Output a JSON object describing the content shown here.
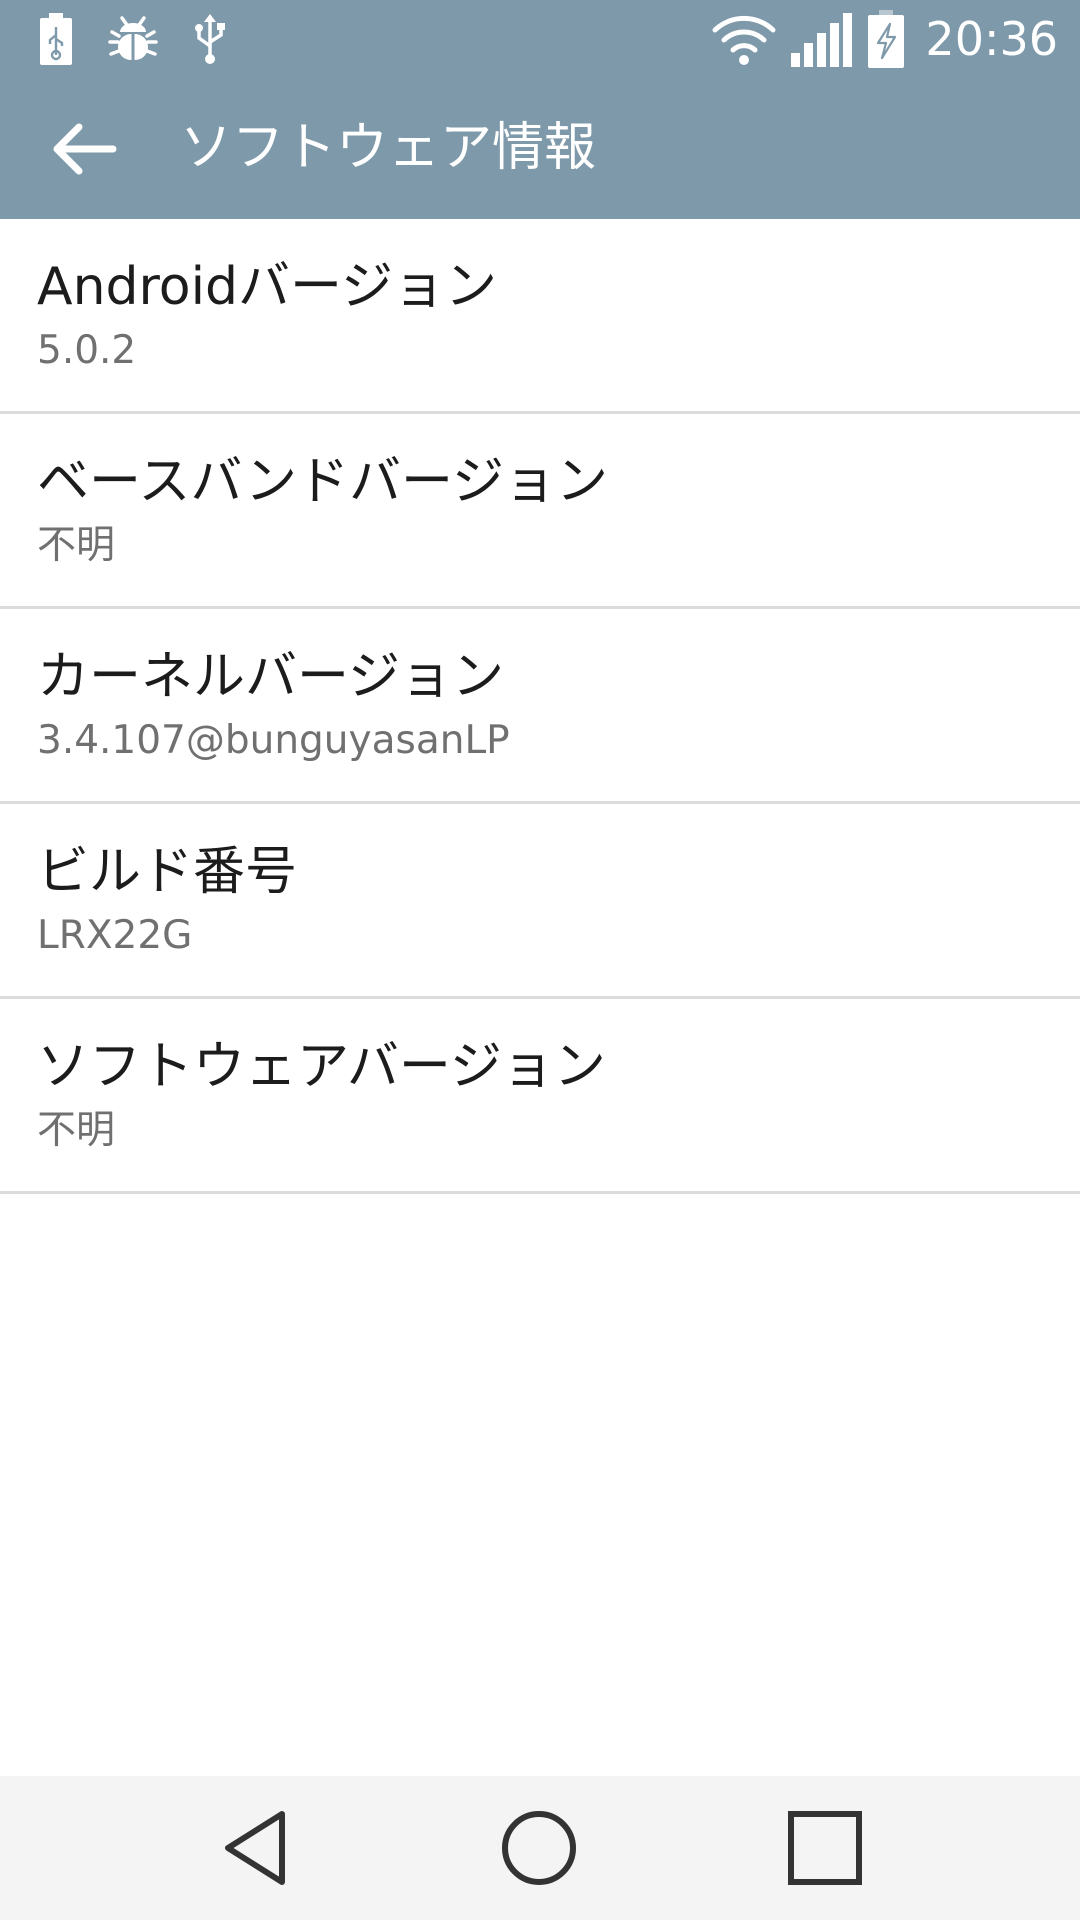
{
  "status_bar": {
    "time": "20:36",
    "left_icons": [
      "battery-usb-icon",
      "bug-icon",
      "usb-icon"
    ],
    "right_icons": [
      "wifi-icon",
      "signal-icon",
      "battery-charging-icon"
    ]
  },
  "action_bar": {
    "back_icon": "arrow-back-icon",
    "title": "ソフトウェア情報"
  },
  "items": [
    {
      "title": "Androidバージョン",
      "value": "5.0.2"
    },
    {
      "title": "ベースバンドバージョン",
      "value": "不明"
    },
    {
      "title": "カーネルバージョン",
      "value": "3.4.107@bunguyasanLP"
    },
    {
      "title": "ビルド番号",
      "value": "LRX22G"
    },
    {
      "title": "ソフトウェアバージョン",
      "value": "不明"
    }
  ],
  "nav_bar": {
    "buttons": [
      "nav-back-icon",
      "nav-home-icon",
      "nav-recents-icon"
    ]
  },
  "colors": {
    "top_bar": "#7e99a9",
    "background": "#ffffff",
    "divider": "#dcdcdc",
    "title_text": "#1c1c1c",
    "value_text": "#707070",
    "nav_bar": "#f4f4f4"
  }
}
